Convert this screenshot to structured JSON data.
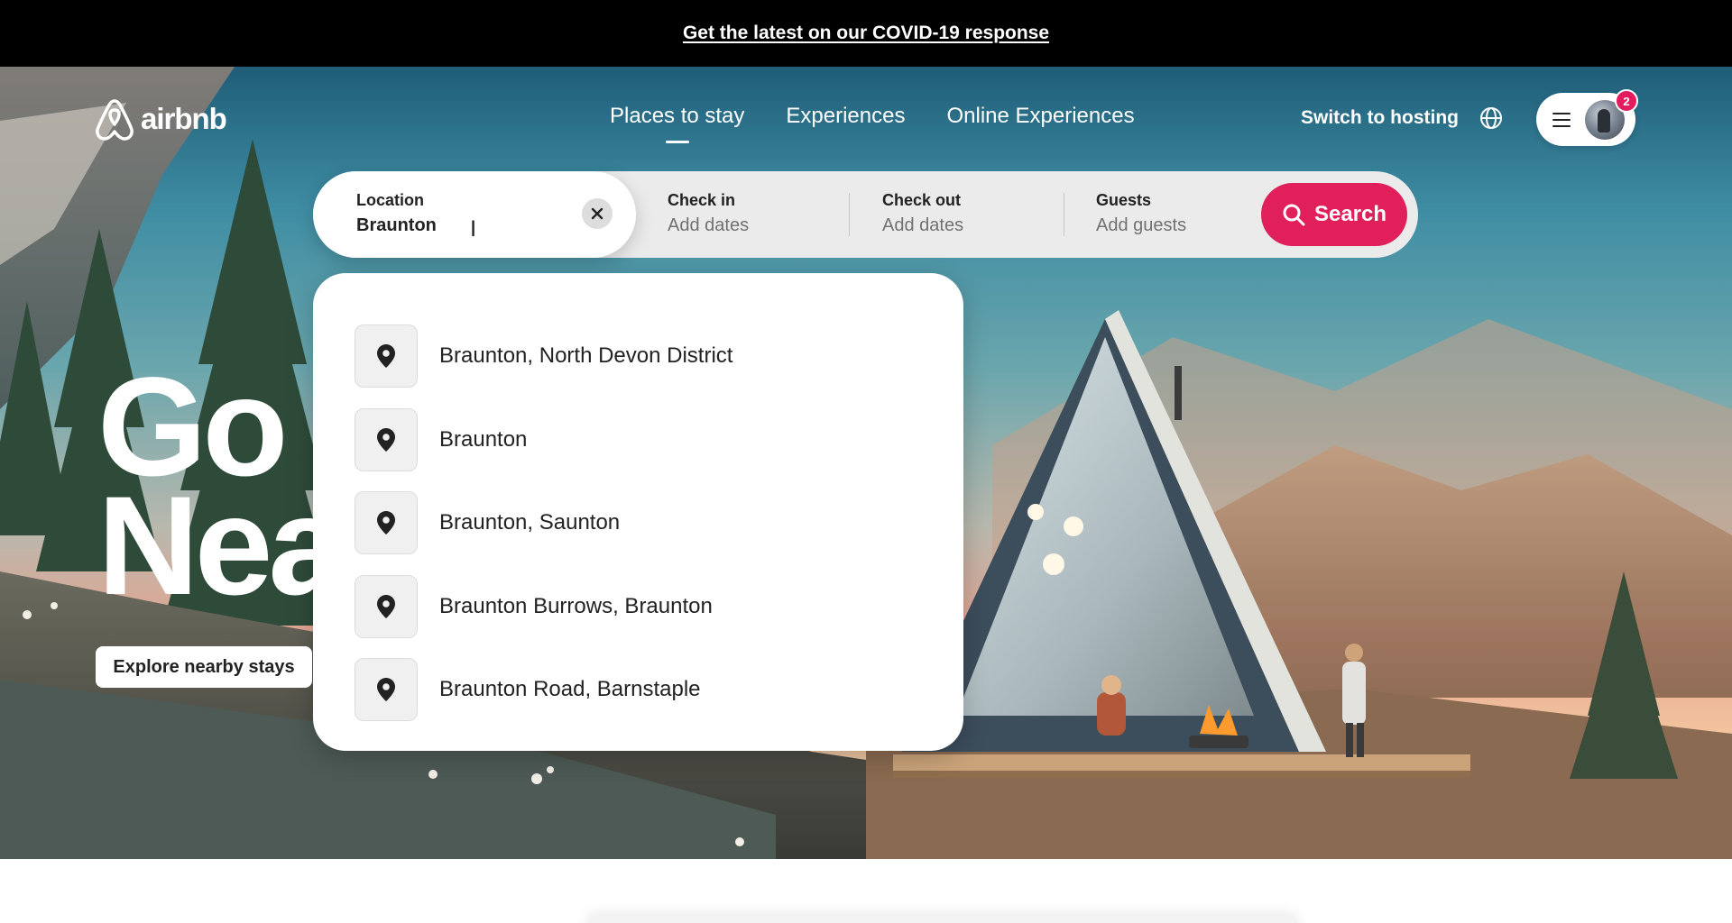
{
  "banner": {
    "link_text": "Get the latest on our COVID-19 response"
  },
  "brand": {
    "name": "airbnb",
    "color": "#ff385c"
  },
  "nav": {
    "tabs": [
      {
        "label": "Places to stay",
        "active": true
      },
      {
        "label": "Experiences",
        "active": false
      },
      {
        "label": "Online Experiences",
        "active": false
      }
    ],
    "switch_hosting": "Switch to hosting",
    "globe_icon": "globe-icon",
    "menu_icon": "hamburger-icon",
    "notification_count": "2"
  },
  "search": {
    "location": {
      "label": "Location",
      "value": "Braunton"
    },
    "check_in": {
      "label": "Check in",
      "placeholder": "Add dates"
    },
    "check_out": {
      "label": "Check out",
      "placeholder": "Add dates"
    },
    "guests": {
      "label": "Guests",
      "placeholder": "Add guests"
    },
    "button_label": "Search",
    "button_color": "#e01f5b"
  },
  "suggestions": [
    {
      "text": "Braunton, North Devon District",
      "icon": "map-pin-icon"
    },
    {
      "text": "Braunton",
      "icon": "map-pin-icon"
    },
    {
      "text": "Braunton, Saunton",
      "icon": "map-pin-icon"
    },
    {
      "text": "Braunton Burrows, Braunton",
      "icon": "map-pin-icon"
    },
    {
      "text": "Braunton Road, Barnstaple",
      "icon": "map-pin-icon"
    }
  ],
  "hero": {
    "title_line1": "Go",
    "title_line2": "Nea",
    "explore_label": "Explore nearby stays"
  }
}
